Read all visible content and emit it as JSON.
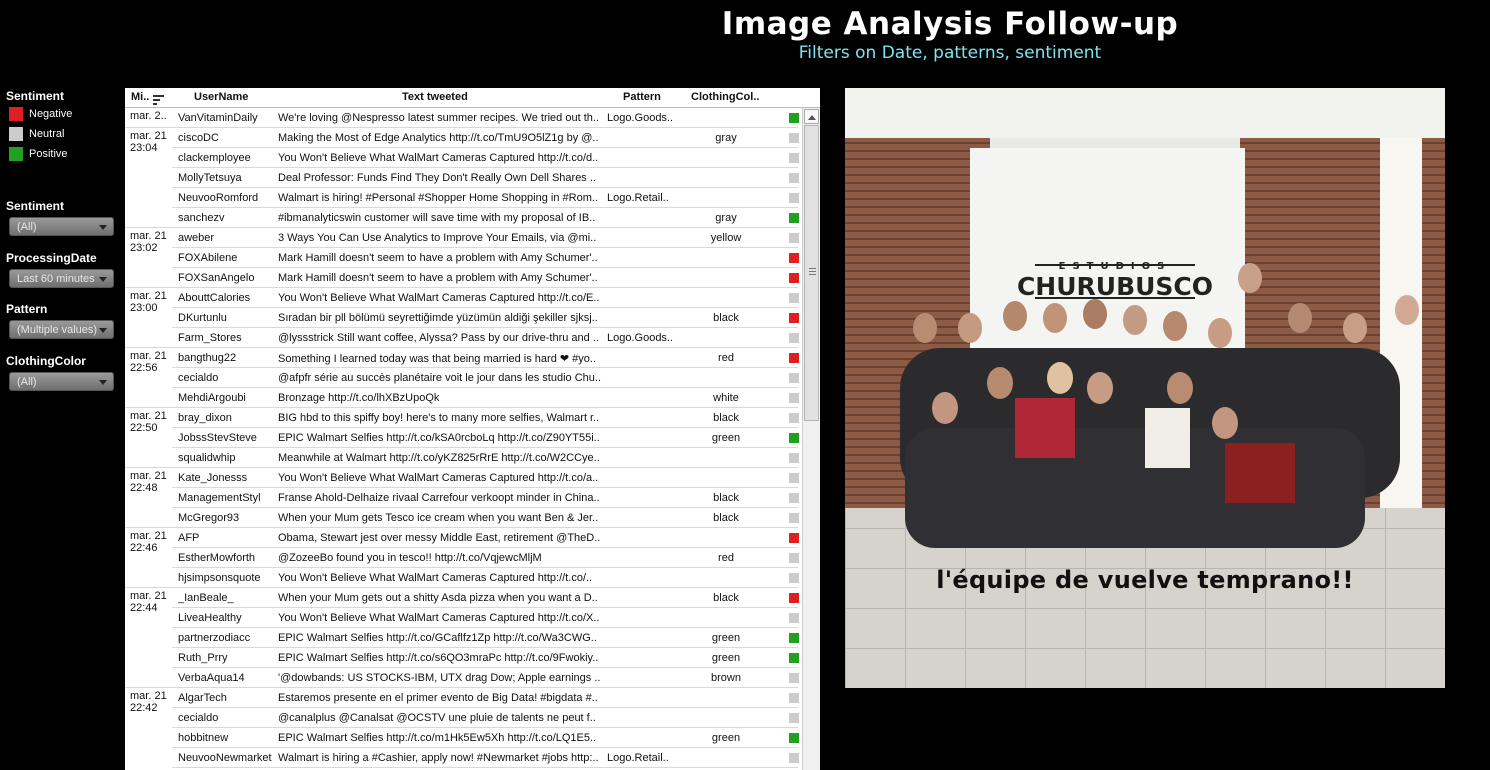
{
  "header": {
    "title": "Image Analysis Follow-up",
    "subtitle": "Filters on Date, patterns, sentiment"
  },
  "sidebar": {
    "legend_title": "Sentiment",
    "legend": [
      {
        "label": "Negative",
        "color": "#e02020"
      },
      {
        "label": "Neutral",
        "color": "#cccccc"
      },
      {
        "label": "Positive",
        "color": "#22a022"
      }
    ],
    "filters": [
      {
        "label": "Sentiment",
        "value": "(All)"
      },
      {
        "label": "ProcessingDate",
        "value": "Last 60 minutes"
      },
      {
        "label": "Pattern",
        "value": "(Multiple values)"
      },
      {
        "label": "ClothingColor",
        "value": "(All)"
      }
    ]
  },
  "table": {
    "columns": [
      "Mi..",
      "UserName",
      "Text tweeted",
      "Pattern",
      "ClothingCol.."
    ],
    "rows": [
      {
        "date": "mar. 2..",
        "user": "VanVitaminDaily",
        "text": "We're loving @Nespresso latest summer recipes. We tried out th..",
        "pattern": "Logo.Goods..",
        "color": "",
        "sentiment": "positive"
      },
      {
        "date": "mar. 21 23:04",
        "user": "ciscoDC",
        "text": "Making the Most of Edge Analytics http://t.co/TmU9O5lZ1g by @..",
        "pattern": "",
        "color": "gray",
        "sentiment": "neutral"
      },
      {
        "date": "",
        "user": "clackemployee",
        "text": "You Won't Believe What WalMart Cameras Captured http://t.co/d..",
        "pattern": "",
        "color": "",
        "sentiment": "neutral"
      },
      {
        "date": "",
        "user": "MollyTetsuya",
        "text": "Deal Professor: Funds Find They Don't Really Own Dell Shares ..",
        "pattern": "",
        "color": "",
        "sentiment": "neutral"
      },
      {
        "date": "",
        "user": "NeuvooRomford",
        "text": "Walmart is hiring! #Personal #Shopper Home Shopping in #Rom..",
        "pattern": "Logo.Retail..",
        "color": "",
        "sentiment": "neutral"
      },
      {
        "date": "",
        "user": "sanchezv",
        "text": "#ibmanalyticswin customer will save time with my proposal of IB..",
        "pattern": "",
        "color": "gray",
        "sentiment": "positive"
      },
      {
        "date": "mar. 21 23:02",
        "user": "aweber",
        "text": "3 Ways You Can Use Analytics to Improve Your Emails, via @mi..",
        "pattern": "",
        "color": "yellow",
        "sentiment": "neutral"
      },
      {
        "date": "",
        "user": "FOXAbilene",
        "text": "Mark Hamill doesn't seem to have a problem with Amy Schumer'..",
        "pattern": "",
        "color": "",
        "sentiment": "negative"
      },
      {
        "date": "",
        "user": "FOXSanAngelo",
        "text": "Mark Hamill doesn't seem to have a problem with Amy Schumer'..",
        "pattern": "",
        "color": "",
        "sentiment": "negative"
      },
      {
        "date": "mar. 21 23:00",
        "user": "AbouttCalories",
        "text": "You Won't Believe What WalMart Cameras Captured http://t.co/E..",
        "pattern": "",
        "color": "",
        "sentiment": "neutral"
      },
      {
        "date": "",
        "user": "DKurtunlu",
        "text": "Sıradan bir pll bölümü seyrettiğimde yüzümün aldiği şekiller sjksj..",
        "pattern": "",
        "color": "black",
        "sentiment": "negative"
      },
      {
        "date": "",
        "user": "Farm_Stores",
        "text": "@lyssstrick Still want coffee, Alyssa? Pass by our drive-thru and ..",
        "pattern": "Logo.Goods..",
        "color": "",
        "sentiment": "neutral"
      },
      {
        "date": "mar. 21 22:56",
        "user": "bangthug22",
        "text": "Something I learned today was that being married is hard ❤ #yo..",
        "pattern": "",
        "color": "red",
        "sentiment": "negative"
      },
      {
        "date": "",
        "user": "cecialdo",
        "text": "@afpfr série au succès planétaire voit le jour dans les studio Chu..",
        "pattern": "",
        "color": "",
        "sentiment": "neutral"
      },
      {
        "date": "",
        "user": "MehdiArgoubi",
        "text": "Bronzage http://t.co/lhXBzUpoQk",
        "pattern": "",
        "color": "white",
        "sentiment": "neutral"
      },
      {
        "date": "mar. 21 22:50",
        "user": "bray_dixon",
        "text": "BIG hbd to this spiffy boy! here's to many more selfies, Walmart r..",
        "pattern": "",
        "color": "black",
        "sentiment": "neutral"
      },
      {
        "date": "",
        "user": "JobssStevSteve",
        "text": "EPIC Walmart Selfies http://t.co/kSA0rcboLq http://t.co/Z90YT55i..",
        "pattern": "",
        "color": "green",
        "sentiment": "positive"
      },
      {
        "date": "",
        "user": "squalidwhip",
        "text": "Meanwhile at Walmart http://t.co/yKZ825rRrE http://t.co/W2CCye..",
        "pattern": "",
        "color": "",
        "sentiment": "neutral"
      },
      {
        "date": "mar. 21 22:48",
        "user": "Kate_Jonesss",
        "text": "You Won't Believe What WalMart Cameras Captured http://t.co/a..",
        "pattern": "",
        "color": "",
        "sentiment": "neutral"
      },
      {
        "date": "",
        "user": "ManagementStyl",
        "text": "Franse Ahold-Delhaize rivaal Carrefour verkoopt minder in China..",
        "pattern": "",
        "color": "black",
        "sentiment": "neutral"
      },
      {
        "date": "",
        "user": "McGregor93",
        "text": "When your Mum gets Tesco ice cream when you want Ben & Jer..",
        "pattern": "",
        "color": "black",
        "sentiment": "neutral"
      },
      {
        "date": "mar. 21 22:46",
        "user": "AFP",
        "text": "Obama, Stewart jest over messy Middle East, retirement @TheD..",
        "pattern": "",
        "color": "",
        "sentiment": "negative"
      },
      {
        "date": "",
        "user": "EstherMowforth",
        "text": "@ZozeeBo found you in tesco!! http://t.co/VqjewcMljM",
        "pattern": "",
        "color": "red",
        "sentiment": "neutral"
      },
      {
        "date": "",
        "user": "hjsimpsonsquote",
        "text": "You Won't Believe What WalMart Cameras Captured http://t.co/..",
        "pattern": "",
        "color": "",
        "sentiment": "neutral"
      },
      {
        "date": "mar. 21 22:44",
        "user": "_IanBeale_",
        "text": "When your Mum gets out a shitty Asda pizza when you want a D..",
        "pattern": "",
        "color": "black",
        "sentiment": "negative"
      },
      {
        "date": "",
        "user": "LiveaHealthy",
        "text": "You Won't Believe What WalMart Cameras Captured http://t.co/X..",
        "pattern": "",
        "color": "",
        "sentiment": "neutral"
      },
      {
        "date": "",
        "user": "partnerzodiacc",
        "text": "EPIC Walmart Selfies http://t.co/GCaflfz1Zp http://t.co/Wa3CWG..",
        "pattern": "",
        "color": "green",
        "sentiment": "positive"
      },
      {
        "date": "",
        "user": "Ruth_Prry",
        "text": "EPIC Walmart Selfies http://t.co/s6QO3mraPc http://t.co/9Fwokiy..",
        "pattern": "",
        "color": "green",
        "sentiment": "positive"
      },
      {
        "date": "",
        "user": "VerbaAqua14",
        "text": "'@dowbands: US STOCKS-IBM, UTX drag Dow; Apple earnings ..",
        "pattern": "",
        "color": "brown",
        "sentiment": "neutral"
      },
      {
        "date": "mar. 21 22:42",
        "user": "AlgarTech",
        "text": "Estaremos presente en el primer evento de Big Data! #bigdata #..",
        "pattern": "",
        "color": "",
        "sentiment": "neutral"
      },
      {
        "date": "",
        "user": "cecialdo",
        "text": "@canalplus @Canalsat @OCSTV une pluie de talents ne peut f..",
        "pattern": "",
        "color": "",
        "sentiment": "neutral"
      },
      {
        "date": "",
        "user": "hobbitnew",
        "text": "EPIC Walmart Selfies http://t.co/m1Hk5Ew5Xh http://t.co/LQ1E5..",
        "pattern": "",
        "color": "green",
        "sentiment": "positive"
      },
      {
        "date": "",
        "user": "NeuvooNewmarket",
        "text": "Walmart is hiring a #Cashier, apply now! #Newmarket #jobs http:..",
        "pattern": "Logo.Retail..",
        "color": "",
        "sentiment": "neutral"
      }
    ]
  },
  "photo": {
    "sign_top": "ESTUDIOS",
    "sign_main": "CHURUBUSCO",
    "caption": "l'équipe de vuelve temprano!!"
  },
  "colors": {
    "negative": "#e02020",
    "neutral": "#cccccc",
    "positive": "#22a022",
    "subtitle": "#7fe3ef"
  }
}
